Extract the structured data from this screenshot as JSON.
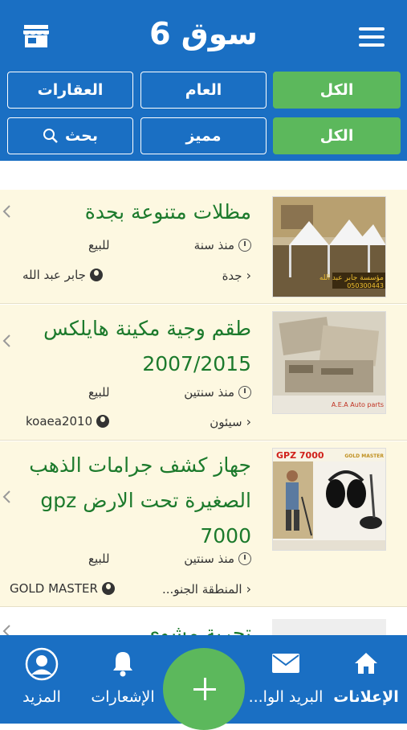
{
  "header": {
    "title": "سوق 6",
    "menu_icon": "hamburger-menu-icon",
    "store_icon": "store-icon"
  },
  "filters": {
    "row1": [
      "الكل",
      "العام",
      "العقارات"
    ],
    "row2": [
      "الكل",
      "مميز",
      "بحث"
    ]
  },
  "colors": {
    "primary": "#1a6fc3",
    "accent": "#5cb85c",
    "title_green": "#1c7a2c",
    "item_bg": "#fdf8e1"
  },
  "listings": [
    {
      "title": "مظلات متنوعة بجدة",
      "time": "منذ سنة",
      "type": "للبيع",
      "location": "جدة",
      "user": "جابر عبد الله",
      "thumb_text": "مؤسسة جابر عبد الله",
      "thumb_phone": "050300443"
    },
    {
      "title": "طقم وجية مكينة هايلكس 2007/2015",
      "time": "منذ سنتين",
      "type": "للبيع",
      "location": "سيئون",
      "user": "koaea2010",
      "thumb_text": "A.E.A Auto parts"
    },
    {
      "title": "جهاز كشف جرامات الذهب الصغيرة تحت الارض gpz 7000",
      "time": "منذ سنتين",
      "type": "للبيع",
      "location": "المنطقة الجنو...",
      "user": "GOLD MASTER",
      "thumb_text": "GPZ 7000",
      "thumb_brand": "GOLD MASTER"
    },
    {
      "title": "تجربة مشوي"
    }
  ],
  "bottom_nav": [
    {
      "label": "الإعلانات",
      "icon": "home-icon"
    },
    {
      "label": "البريد الوا...",
      "icon": "mail-icon"
    },
    {
      "label": "الإشعارات",
      "icon": "bell-icon"
    },
    {
      "label": "المزيد",
      "icon": "profile-icon"
    }
  ],
  "fab": {
    "icon": "plus-icon"
  }
}
